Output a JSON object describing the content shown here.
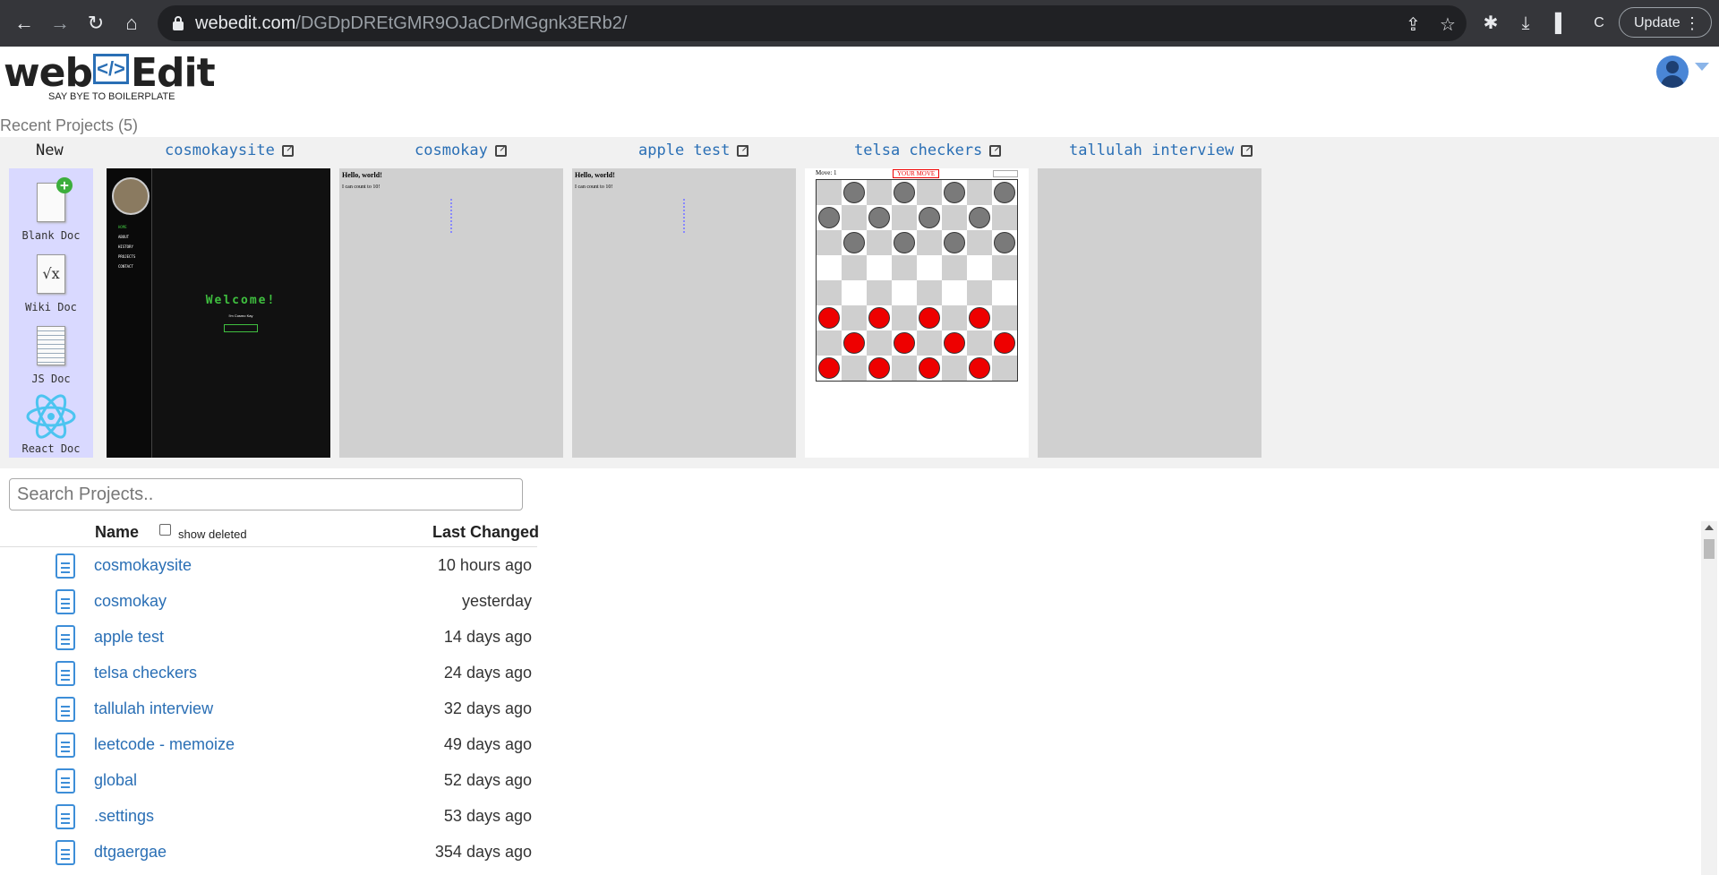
{
  "browser": {
    "url_domain": "webedit.com",
    "url_path": "/DGDpDREtGMR9OJaCDrMGgnk3ERb2/",
    "profile_initial": "C",
    "update_label": "Update"
  },
  "app": {
    "logo_left": "web",
    "logo_code": "</>",
    "logo_right": "Edit",
    "tagline": "SAY BYE TO BOILERPLATE"
  },
  "recent": {
    "title": "Recent Projects (5)",
    "new_label": "New",
    "new_docs": [
      {
        "label": "Blank Doc",
        "icon": "blank-doc-icon"
      },
      {
        "label": "Wiki Doc",
        "icon": "wiki-doc-icon"
      },
      {
        "label": "JS Doc",
        "icon": "js-doc-icon"
      },
      {
        "label": "React Doc",
        "icon": "react-doc-icon"
      }
    ],
    "projects": [
      {
        "name": "cosmokaysite"
      },
      {
        "name": "cosmokay"
      },
      {
        "name": "apple test"
      },
      {
        "name": "telsa checkers"
      },
      {
        "name": "tallulah interview"
      }
    ],
    "thumb_texts": {
      "welcome": "Welcome!",
      "hello": "Hello, world!",
      "count": "I can count to 10!",
      "moves": "Move: 1",
      "your_move": "YOUR MOVE",
      "nav": [
        "HOME",
        "ABOUT",
        "HISTORY",
        "PROJECTS",
        "CONTACT"
      ],
      "subline": "I'm Cosmo Kay"
    }
  },
  "search": {
    "placeholder": "Search Projects.."
  },
  "table": {
    "col_name": "Name",
    "show_deleted": "show deleted",
    "col_last": "Last Changed",
    "rows": [
      {
        "name": "cosmokaysite",
        "date": "10 hours ago"
      },
      {
        "name": "cosmokay",
        "date": "yesterday"
      },
      {
        "name": "apple test",
        "date": "14 days ago"
      },
      {
        "name": "telsa checkers",
        "date": "24 days ago"
      },
      {
        "name": "tallulah interview",
        "date": "32 days ago"
      },
      {
        "name": "leetcode - memoize",
        "date": "49 days ago"
      },
      {
        "name": "global",
        "date": "52 days ago"
      },
      {
        "name": ".settings",
        "date": "53 days ago"
      },
      {
        "name": "dtgaergae",
        "date": "354 days ago"
      }
    ]
  }
}
